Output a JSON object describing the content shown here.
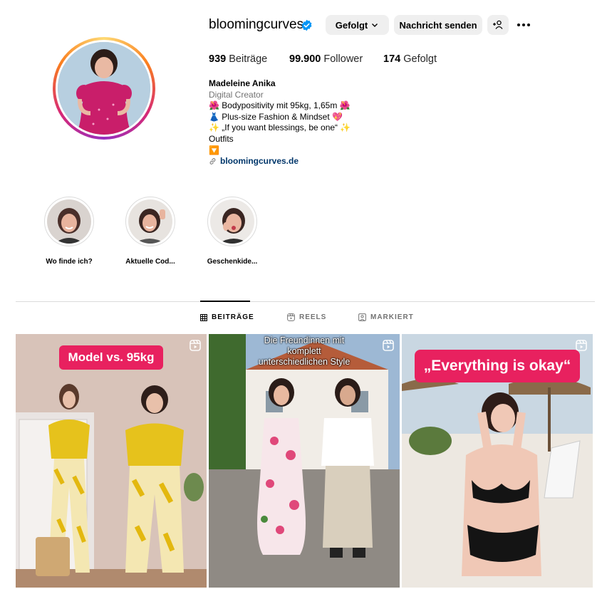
{
  "profile": {
    "username": "bloomingcurves",
    "verified_icon": "verified-badge-icon",
    "buttons": {
      "following": "Gefolgt",
      "message": "Nachricht senden"
    },
    "stats": {
      "posts_count": "939",
      "posts_label": "Beiträge",
      "followers_count": "99.900",
      "followers_label": "Follower",
      "following_count": "174",
      "following_label": "Gefolgt"
    },
    "bio": {
      "name": "Madeleine Anika",
      "category": "Digital Creator",
      "line1": "🌺 Bodypositivity mit 95kg, 1,65m 🌺",
      "line2": "👗 Plus-size Fashion & Mindset 💖",
      "line3": "✨ „If you want blessings, be one“ ✨",
      "line4": "Outfits",
      "line5": "🔽",
      "link": "bloomingcurves.de"
    }
  },
  "highlights": [
    {
      "label": "Wo finde ich?"
    },
    {
      "label": "Aktuelle Cod..."
    },
    {
      "label": "Geschenkide..."
    }
  ],
  "tabs": [
    {
      "label": "BEITRÄGE",
      "icon": "grid-icon",
      "active": true
    },
    {
      "label": "REELS",
      "icon": "reels-icon",
      "active": false
    },
    {
      "label": "MARKIERT",
      "icon": "tagged-icon",
      "active": false
    }
  ],
  "posts": [
    {
      "overlay": "Model vs. 95kg",
      "type_icon": "reel-icon"
    },
    {
      "overlay_line1": "Die Freundinnen mit",
      "overlay_line2": "komplett",
      "overlay_line3": "unterschiedlichen Style",
      "type_icon": "reel-icon"
    },
    {
      "overlay": "„Everything is okay“",
      "type_icon": "reel-icon"
    }
  ],
  "colors": {
    "brand_pink": "#e8215f",
    "link_blue": "#00376b",
    "verified_blue": "#0095f6",
    "button_grey": "#efefef"
  }
}
